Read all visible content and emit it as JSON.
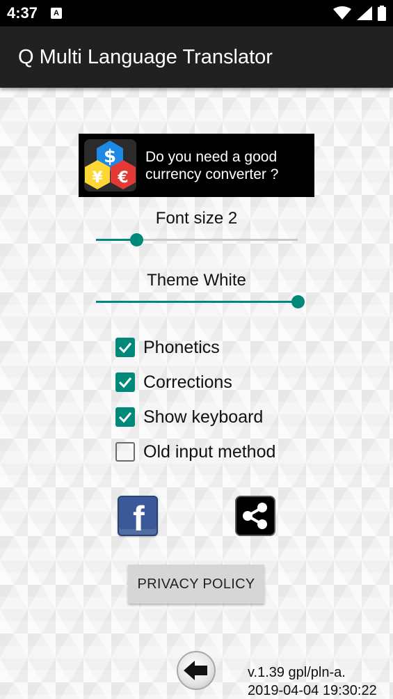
{
  "status_bar": {
    "time": "4:37",
    "notification_letter": "A",
    "icons": [
      "wifi-icon",
      "signal-icon",
      "battery-icon"
    ]
  },
  "app_bar": {
    "title": "Q Multi Language Translator"
  },
  "ad": {
    "text": "Do you need a good currency converter ?",
    "icon": "currency-symbols-icon"
  },
  "font_size": {
    "label": "Font size  2",
    "level": 0.2
  },
  "theme": {
    "label": "Theme  White",
    "level": 1.0
  },
  "options": [
    {
      "label": "Phonetics",
      "checked": true
    },
    {
      "label": "Corrections",
      "checked": true
    },
    {
      "label": "Show keyboard",
      "checked": true
    },
    {
      "label": "Old input method",
      "checked": false
    }
  ],
  "buttons": {
    "facebook_icon": "facebook-icon",
    "share_icon": "share-icon",
    "privacy_label": "PRIVACY POLICY",
    "back_icon": "back-arrow-icon"
  },
  "version": {
    "line1": "v.1.39 gpl/pln-a.",
    "line2": "2019-04-04  19:30:22"
  },
  "colors": {
    "accent": "#00897b",
    "app_bar": "#212121",
    "status_bar": "#000000"
  }
}
